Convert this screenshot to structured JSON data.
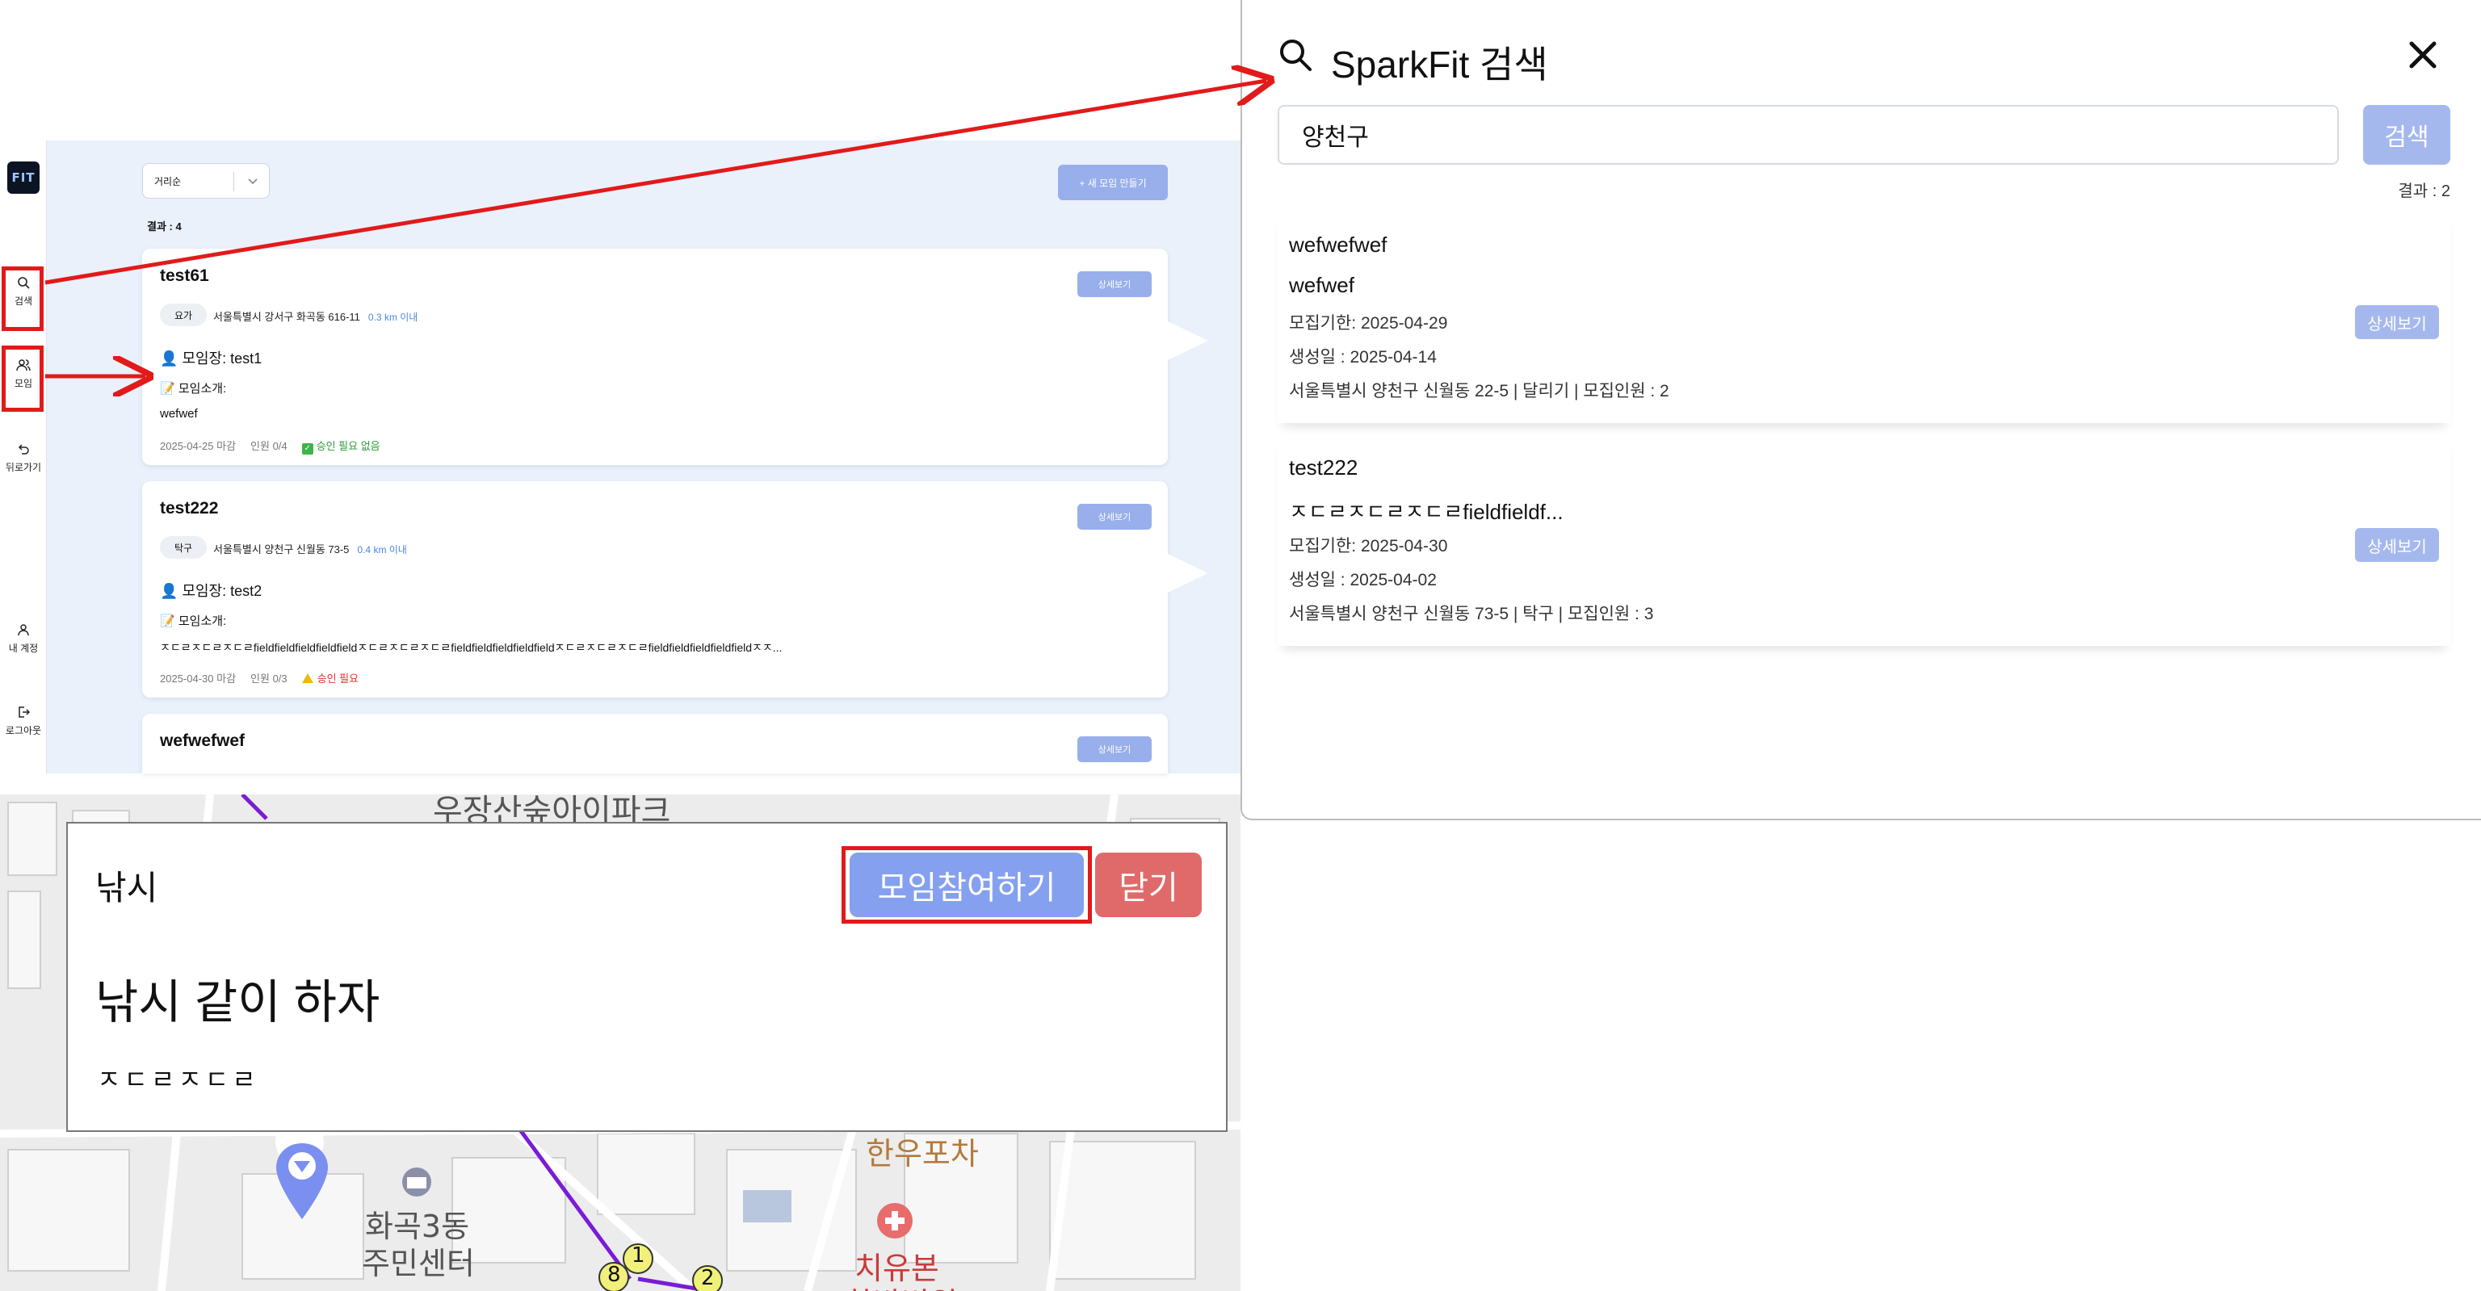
{
  "sidebar": {
    "logo": "FIT",
    "items": [
      {
        "label": "검색"
      },
      {
        "label": "모임"
      },
      {
        "label": "뒤로가기"
      },
      {
        "label": "내 계정"
      },
      {
        "label": "로그아웃"
      }
    ]
  },
  "toolbar": {
    "sort_value": "거리순",
    "new_button": "+ 새 모임 만들기"
  },
  "results_count": "결과 : 4",
  "cards": [
    {
      "title": "test61",
      "detail_label": "상세보기",
      "tag": "요가",
      "address": "서울특별시 강서구 화곡동 616-11",
      "distance": "0.3 km 이내",
      "leader": "모임장: test1",
      "intro_label": "모임소개:",
      "intro_text": "wefwef",
      "deadline": "2025-04-25 마감",
      "members": "인원 0/4",
      "approval": "승인 필요 없음"
    },
    {
      "title": "test222",
      "detail_label": "상세보기",
      "tag": "탁구",
      "address": "서울특별시 양천구 신월동 73-5",
      "distance": "0.4 km 이내",
      "leader": "모임장: test2",
      "intro_label": "모임소개:",
      "intro_text": "ㅈㄷㄹㅈㄷㄹㅈㄷㄹfieldfieldfieldfieldfieldㅈㄷㄹㅈㄷㄹㅈㄷㄹfieldfieldfieldfieldfieldㅈㄷㄹㅈㄷㄹㅈㄷㄹfieldfieldfieldfieldfieldㅈㅈ...",
      "deadline": "2025-04-30 마감",
      "members": "인원 0/3",
      "approval": "승인 필요"
    },
    {
      "title": "wefwefwef",
      "detail_label": "상세보기"
    }
  ],
  "map_labels": {
    "top": "우장산숲아이파크",
    "restaurant": "한우포차",
    "center_l1": "화곡3동",
    "center_l2": "주민센터",
    "clinic_l1": "치유본",
    "clinic_l2": "한방병원",
    "markers": [
      "1",
      "2",
      "8"
    ]
  },
  "modal": {
    "title": "낚시",
    "join_button": "모임참여하기",
    "close_button": "닫기",
    "description": "낚시 같이 하자",
    "text": "ㅈㄷㄹㅈㄷㄹ"
  },
  "search": {
    "title": "SparkFit 검색",
    "query": "양천구",
    "button": "검색",
    "count": "결과 : 2",
    "results": [
      {
        "name": "wefwefwef",
        "desc": "wefwef",
        "deadline": "모집기한: 2025-04-29",
        "created": "생성일 : 2025-04-14",
        "info": "서울특별시 양천구 신월동 22-5 | 달리기 | 모집인원 : 2",
        "button": "상세보기"
      },
      {
        "name": "test222",
        "desc": "ㅈㄷㄹㅈㄷㄹㅈㄷㄹfieldfieldf...",
        "deadline": "모집기한: 2025-04-30",
        "created": "생성일 : 2025-04-02",
        "info": "서울특별시 양천구 신월동 73-5 | 탁구 | 모집인원 : 3",
        "button": "상세보기"
      }
    ]
  },
  "colors": {
    "accent": "#98afeb",
    "highlight": "#e21a1a",
    "close": "#e06a6a"
  }
}
